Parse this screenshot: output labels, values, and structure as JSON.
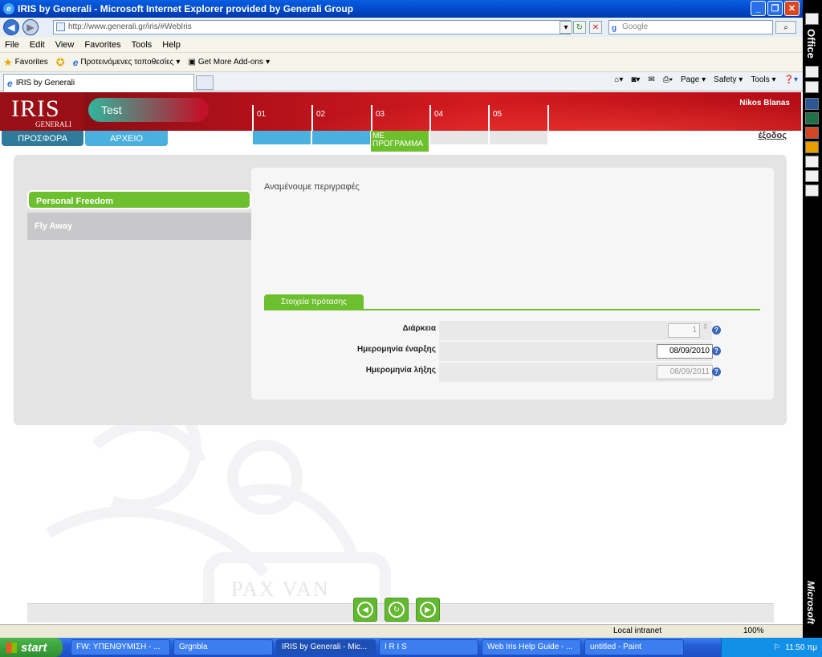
{
  "window": {
    "title": "IRIS by Generali - Microsoft Internet Explorer provided by Generali Group",
    "minimize": "_",
    "maximize": "❐",
    "close": "✕"
  },
  "address_bar": {
    "url": "http://www.generali.gr/iris/#WebIris",
    "search_placeholder": "Google"
  },
  "menu": [
    "File",
    "Edit",
    "View",
    "Favorites",
    "Tools",
    "Help"
  ],
  "favorites_bar": {
    "favorites_label": "Favorites",
    "suggested": "Προτεινόμενες τοποθεσίες",
    "addons": "Get More Add-ons"
  },
  "browser_tab": {
    "title": "IRIS by Generali"
  },
  "command_bar": {
    "page": "Page",
    "safety": "Safety",
    "tools": "Tools"
  },
  "office_bar": {
    "office": "Office",
    "microsoft": "Microsoft"
  },
  "app": {
    "logo_main": "IRIS",
    "logo_sub": "GENERALI",
    "case_name": "Test",
    "user_name": "Nikos Blanas",
    "logout": "έξοδος",
    "tabs": [
      "ΠΡΟΣΦΟΡΑ",
      "ΑΡΧΕΙΟ"
    ],
    "steps": [
      {
        "number": "01",
        "label": ""
      },
      {
        "number": "02",
        "label": ""
      },
      {
        "number": "03",
        "label": "ΜΕ ΠΡΟΓΡΑΜΜΑ"
      },
      {
        "number": "04",
        "label": ""
      },
      {
        "number": "05",
        "label": ""
      }
    ],
    "products": [
      "Personal Freedom",
      "Fly Away"
    ],
    "description": "Αναμένουμε περιγραφές",
    "section_title": "Στοιχεία πρότασης",
    "form": {
      "duration_label": "Διάρκεια",
      "duration_value": "1",
      "start_label": "Ημερομηνία έναρξης",
      "start_value": "08/09/2010",
      "end_label": "Ημερομηνία λήξης",
      "end_value": "08/09/2011"
    },
    "watermark": "PAX VAN"
  },
  "status_bar": {
    "zone": "Local intranet",
    "zoom": "100%"
  },
  "taskbar": {
    "start": "start",
    "items": [
      "FW: ΥΠΕΝΘΥΜΙΣΗ - ...",
      "Grgnbla",
      "IRIS by Generali - Mic...",
      "I R I S",
      "Web Iris Help Guide - ...",
      "untitled - Paint"
    ],
    "language": "EN",
    "clock": "11:50 πμ"
  },
  "colors": {
    "accent_green": "#6cbf2d",
    "banner_red": "#c2121c",
    "tab_blue": "#3aa0d8",
    "tab_teal": "#2f7b9c"
  }
}
